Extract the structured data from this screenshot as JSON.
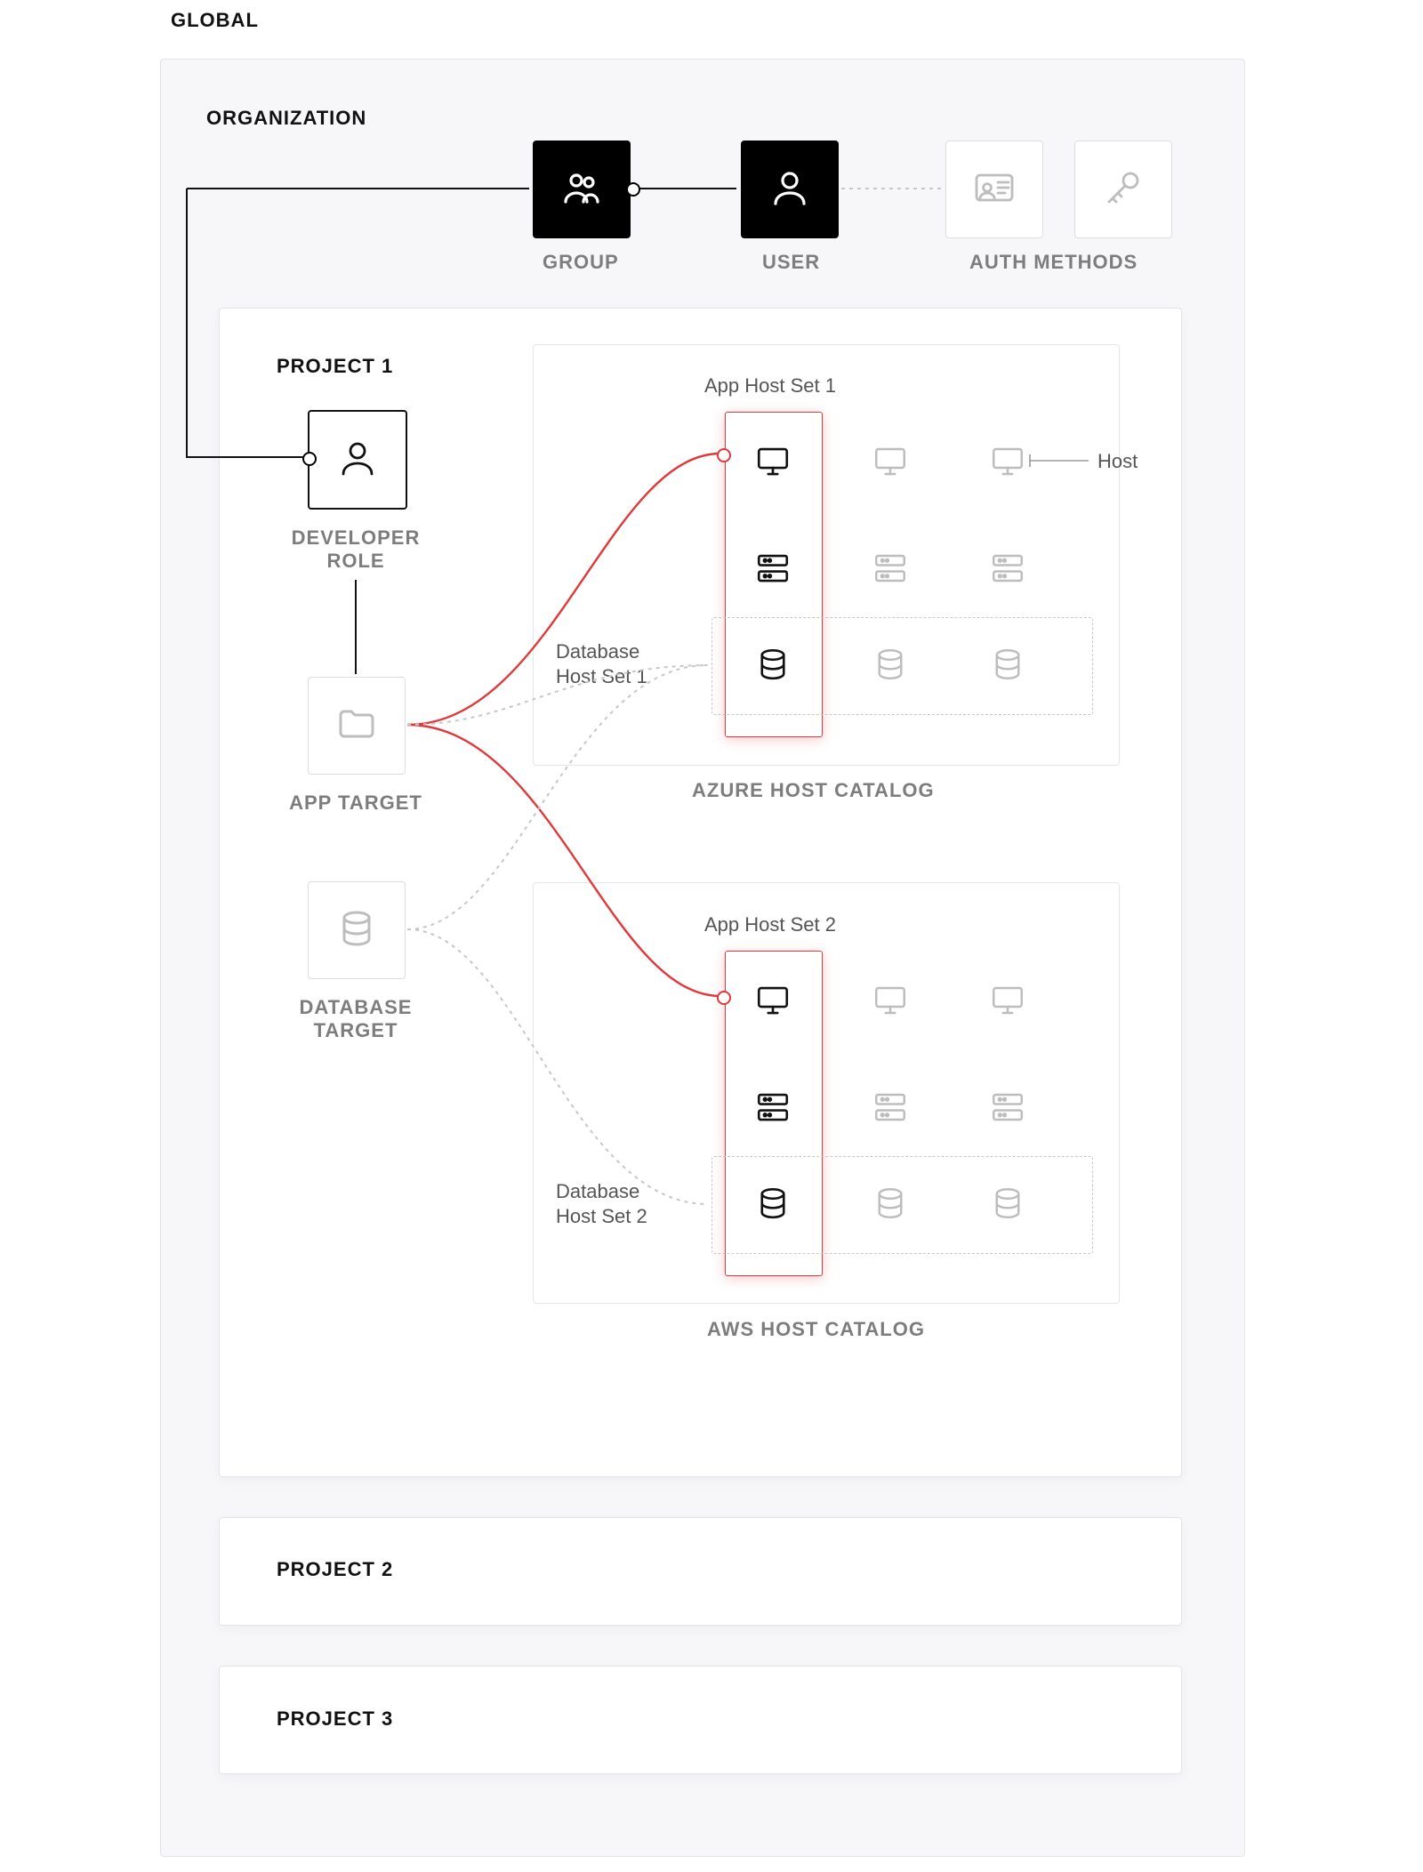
{
  "labels": {
    "global": "GLOBAL",
    "organization": "ORGANIZATION",
    "group": "GROUP",
    "user": "USER",
    "auth_methods": "AUTH METHODS",
    "project1": "PROJECT 1",
    "developer_role_line1": "DEVELOPER",
    "developer_role_line2": "ROLE",
    "app_target": "APP TARGET",
    "database_target_line1": "DATABASE",
    "database_target_line2": "TARGET",
    "azure_host_catalog": "AZURE HOST CATALOG",
    "aws_host_catalog": "AWS HOST CATALOG",
    "project2": "PROJECT 2",
    "project3": "PROJECT 3",
    "app_host_set_1": "App Host Set 1",
    "app_host_set_2": "App Host Set 2",
    "db_host_set_1_l1": "Database",
    "db_host_set_1_l2": "Host Set 1",
    "db_host_set_2_l1": "Database",
    "db_host_set_2_l2": "Host Set 2",
    "host": "Host"
  },
  "colors": {
    "accent_red": "#e2383a",
    "ink": "#111",
    "muted": "#b9b9b9",
    "panel_bg": "#f7f7f9",
    "panel_border": "#e3e3e8"
  },
  "icons": {
    "group": "group-icon",
    "user": "user-icon",
    "id_card": "id-card-icon",
    "key": "key-icon",
    "role_user": "user-icon",
    "folder": "folder-icon",
    "database": "database-icon",
    "monitor": "monitor-icon",
    "server": "server-icon"
  }
}
